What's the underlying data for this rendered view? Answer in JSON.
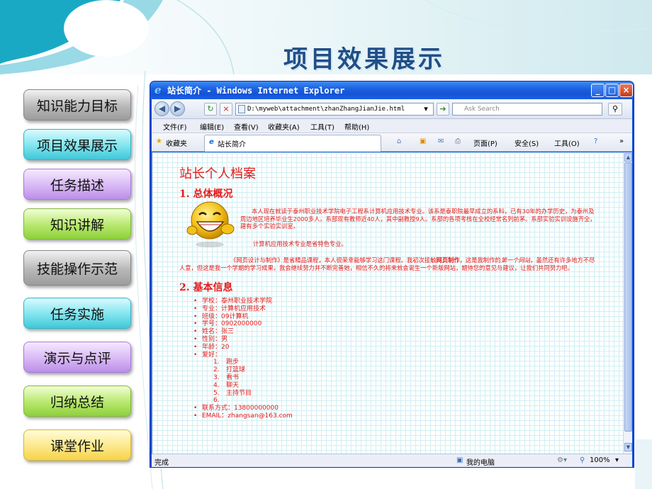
{
  "slide": {
    "title": "项目效果展示",
    "nav": [
      {
        "label": "知识能力目标",
        "style": "gray"
      },
      {
        "label": "项目效果展示",
        "style": "cyan"
      },
      {
        "label": "任务描述",
        "style": "purple"
      },
      {
        "label": "知识讲解",
        "style": "green"
      },
      {
        "label": "技能操作示范",
        "style": "gray"
      },
      {
        "label": "任务实施",
        "style": "cyan"
      },
      {
        "label": "演示与点评",
        "style": "purple"
      },
      {
        "label": "归纳总结",
        "style": "green"
      },
      {
        "label": "课堂作业",
        "style": "yellow"
      }
    ]
  },
  "browser": {
    "window_title": "站长简介 - Windows Internet Explorer",
    "address": "D:\\myweb\\attachment\\zhanZhangJianJie.html",
    "search_placeholder": "Ask Search",
    "menu": [
      "文件(F)",
      "编辑(E)",
      "查看(V)",
      "收藏夹(A)",
      "工具(T)",
      "帮助(H)"
    ],
    "favorites_label": "收藏夹",
    "tab_label": "站长简介",
    "toolbar": {
      "page": "页面(P)",
      "safety": "安全(S)",
      "tools": "工具(O)"
    },
    "status": {
      "left": "完成",
      "zone": "我的电脑",
      "zoom": "100%"
    }
  },
  "page": {
    "heading": "站长个人档案",
    "section1_title": "1. 总体概况",
    "intro_p1": "本人现在就读于泰州职业技术学院电子工程系计算机应用技术专业。该系是泰职院最早成立的系科，已有30年的办学历史，为泰州及周边地区培养毕业生2000多人。系部现有教师近40人，其中副教授9人。系部的各项考核在全校经常名列前茅。系部实验实训设施齐全，建有多个实验实训室。",
    "intro_p2": "计算机应用技术专业是省特色专业。",
    "intro_p3_a": "《网页设计与制作》是省精品课程，本人很荣幸能够学习这门课程。我初次接触",
    "intro_p3_bold": "网页制作",
    "intro_p3_b": "，这是我制作的",
    "intro_p3_italic": "第一个网站",
    "intro_p3_c": "，虽然还有许多地方不尽人意，但这是我一个学期的学习成果，我会继续努力并不断完善她，相信不久的将来就会诞生一个新版网站，期待您的意见与建议，让我们共同努力吧。",
    "section2_title": "2. 基本信息",
    "info": [
      "学校：泰州职业技术学院",
      "专业：计算机应用技术",
      "班级：09计算机",
      "学号：0902000000",
      "姓名：张三",
      "性别：男",
      "年龄：20",
      "爱好："
    ],
    "hobbies": [
      "跑步",
      "打篮球",
      "看书",
      "聊天",
      "主持节目",
      ""
    ],
    "contact": "联系方式：13800000000",
    "email": "EMAIL：zhangsan@163.com"
  }
}
